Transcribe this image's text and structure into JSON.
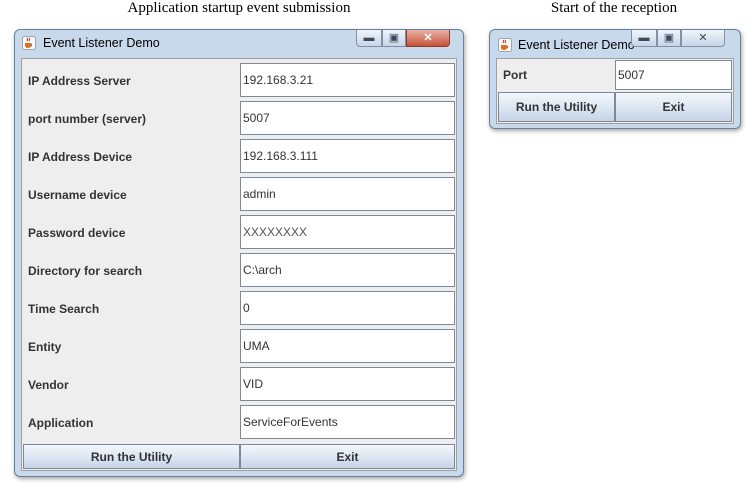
{
  "captions": {
    "left": "Application startup event submission",
    "right": "Start of the reception"
  },
  "main_window": {
    "title": "Event Listener Demo",
    "fields": [
      {
        "label": "IP Address Server",
        "value": "192.168.3.21"
      },
      {
        "label": "port number (server)",
        "value": "5007"
      },
      {
        "label": "IP Address Device",
        "value": "192.168.3.111"
      },
      {
        "label": "Username device",
        "value": "admin"
      },
      {
        "label": "Password device",
        "value": "XXXXXXXX"
      },
      {
        "label": "Directory for search",
        "value": "C:\\arch"
      },
      {
        "label": "Time Search",
        "value": "0"
      },
      {
        "label": "Entity",
        "value": "UMA"
      },
      {
        "label": "Vendor",
        "value": "VID"
      },
      {
        "label": "Application",
        "value": "ServiceForEvents"
      }
    ],
    "run_label": "Run the Utility",
    "exit_label": "Exit"
  },
  "small_window": {
    "title": "Event Listener Demo",
    "port_label": "Port",
    "port_value": "5007",
    "run_label": "Run the Utility",
    "exit_label": "Exit"
  },
  "icons": {
    "app": "java-cup-icon",
    "minimize": "minimize-icon",
    "maximize": "maximize-icon",
    "close": "close-icon"
  }
}
